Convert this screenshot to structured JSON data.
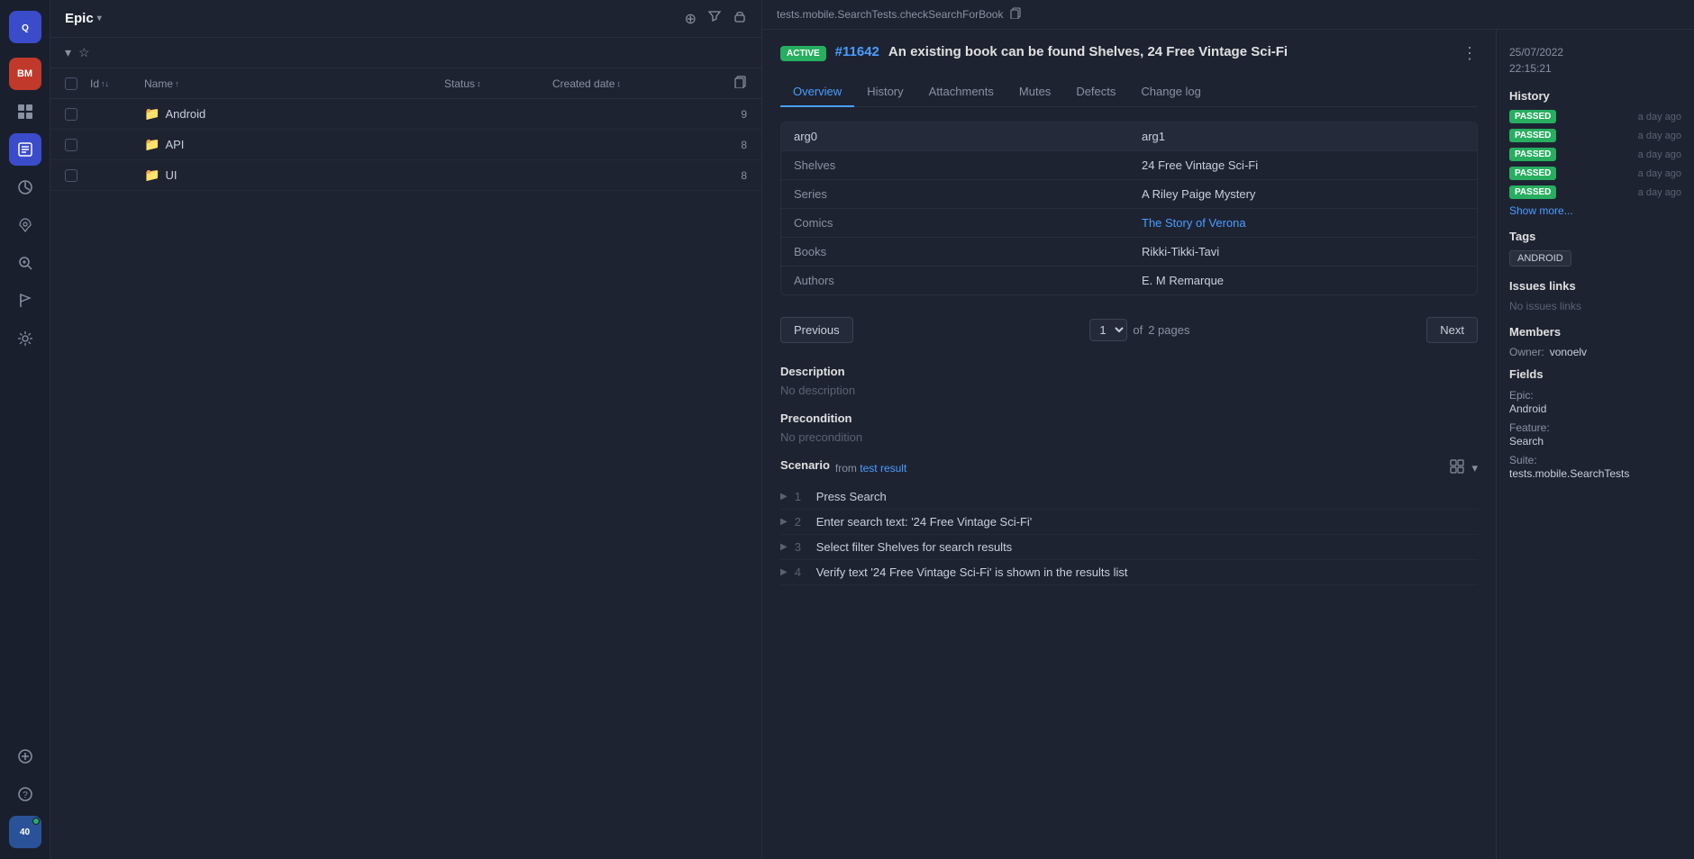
{
  "app": {
    "title": "Epic"
  },
  "sidebar": {
    "logo": "Q",
    "avatar_label": "BM",
    "icons": [
      {
        "name": "dashboard-icon",
        "symbol": "⊞",
        "active": false
      },
      {
        "name": "test-runs-icon",
        "symbol": "▶",
        "active": true
      },
      {
        "name": "reports-icon",
        "symbol": "◎",
        "active": false
      },
      {
        "name": "rocket-icon",
        "symbol": "🚀",
        "active": false
      },
      {
        "name": "search-icon",
        "symbol": "⊙",
        "active": false
      },
      {
        "name": "flag-icon",
        "symbol": "⚑",
        "active": false
      },
      {
        "name": "settings-icon",
        "symbol": "⚙",
        "active": false
      },
      {
        "name": "add-icon",
        "symbol": "+",
        "active": false
      },
      {
        "name": "help-icon",
        "symbol": "?",
        "active": false
      }
    ]
  },
  "main_panel": {
    "title": "Epic",
    "header_actions": {
      "add": "+",
      "filter": "▽",
      "lock": "🔒"
    },
    "table": {
      "columns": {
        "id": "Id",
        "name": "Name",
        "status": "Status",
        "created_date": "Created date"
      },
      "rows": [
        {
          "id": "",
          "name": "Android",
          "status": "",
          "created": "",
          "count": 9,
          "icon": "📁"
        },
        {
          "id": "",
          "name": "API",
          "status": "",
          "created": "",
          "count": 8,
          "icon": "📁"
        },
        {
          "id": "",
          "name": "UI",
          "status": "",
          "created": "",
          "count": 8,
          "icon": "📁"
        }
      ]
    }
  },
  "breadcrumb": "tests.mobile.SearchTests.checkSearchForBook",
  "test_detail": {
    "status": "ACTIVE",
    "number": "#11642",
    "title": "An existing book can be found Shelves, 24 Free Vintage Sci-Fi",
    "tabs": [
      "Overview",
      "History",
      "Attachments",
      "Mutes",
      "Defects",
      "Change log"
    ],
    "active_tab": "Overview",
    "args": {
      "headers": [
        "arg0",
        "arg1"
      ],
      "rows": [
        {
          "key": "Shelves",
          "value": "24 Free Vintage Sci-Fi",
          "is_link": false
        },
        {
          "key": "Series",
          "value": "A Riley Paige Mystery",
          "is_link": false
        },
        {
          "key": "Comics",
          "value": "The Story of Verona",
          "is_link": true
        },
        {
          "key": "Books",
          "value": "Rikki-Tikki-Tavi",
          "is_link": false
        },
        {
          "key": "Authors",
          "value": "E. M Remarque",
          "is_link": false
        }
      ]
    },
    "pagination": {
      "previous_label": "Previous",
      "next_label": "Next",
      "current_page": "1",
      "total_pages": "2"
    },
    "description": {
      "title": "Description",
      "empty_text": "No description"
    },
    "precondition": {
      "title": "Precondition",
      "empty_text": "No precondition"
    },
    "scenario": {
      "title": "Scenario",
      "source_label": "from",
      "source_link": "test result",
      "steps": [
        {
          "num": 1,
          "text": "Press Search"
        },
        {
          "num": 2,
          "text": "Enter search text: '24 Free Vintage Sci-Fi'"
        },
        {
          "num": 3,
          "text": "Select filter Shelves for search results"
        },
        {
          "num": 4,
          "text": "Verify text '24 Free Vintage Sci-Fi' is shown in the results list"
        }
      ]
    }
  },
  "right_sidebar": {
    "date": "25/07/2022\n22:15:21",
    "history": {
      "title": "History",
      "items": [
        {
          "status": "PASSED",
          "time": "a day ago"
        },
        {
          "status": "PASSED",
          "time": "a day ago"
        },
        {
          "status": "PASSED",
          "time": "a day ago"
        },
        {
          "status": "PASSED",
          "time": "a day ago"
        },
        {
          "status": "PASSED",
          "time": "a day ago"
        }
      ],
      "show_more": "Show more..."
    },
    "tags": {
      "title": "Tags",
      "items": [
        "ANDROID"
      ]
    },
    "issues_links": {
      "title": "Issues links",
      "empty_text": "No issues links"
    },
    "members": {
      "title": "Members",
      "owner_label": "Owner:",
      "owner_value": "vonoelv"
    },
    "fields": {
      "title": "Fields",
      "items": [
        {
          "label": "Epic:",
          "value": "Android"
        },
        {
          "label": "Feature:",
          "value": "Search"
        },
        {
          "label": "Suite:",
          "value": "tests.mobile.SearchTests"
        }
      ]
    }
  }
}
